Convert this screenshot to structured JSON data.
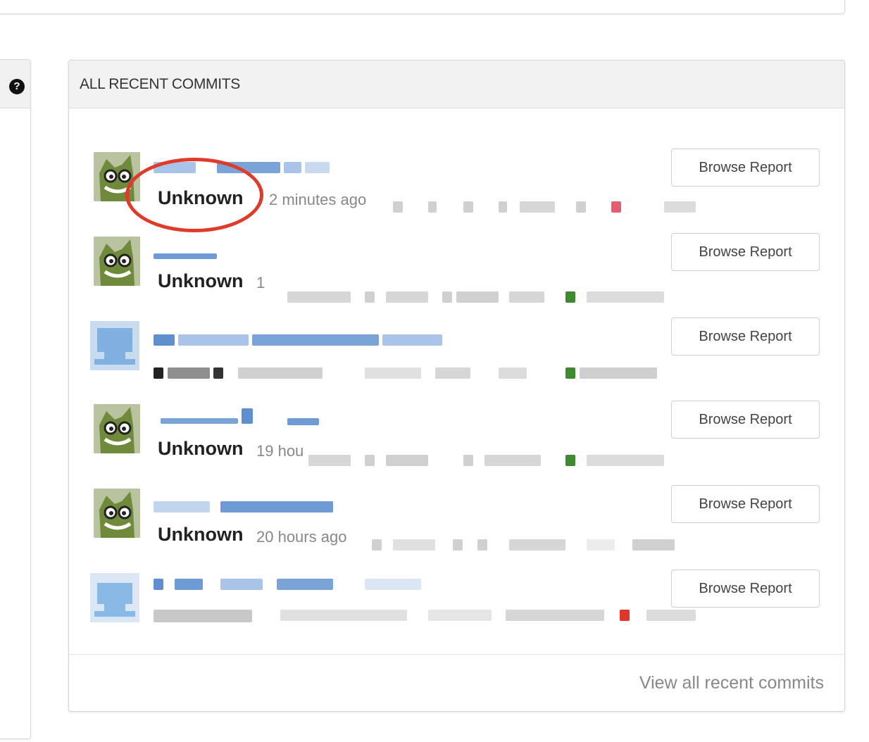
{
  "panel": {
    "title": "ALL RECENT COMMITS",
    "view_all_label": "View all recent commits"
  },
  "left_panel": {
    "help_icon": "question-circle-icon"
  },
  "commits": [
    {
      "author": "Unknown",
      "time": "2 minutes ago",
      "avatar": "monster-avatar-icon",
      "button_label": "Browse Report",
      "status_color": "#e06070"
    },
    {
      "author": "Unknown",
      "time": "1",
      "avatar": "monster-avatar-icon",
      "button_label": "Browse Report",
      "status_color": "#3f8a2e"
    },
    {
      "author": "",
      "time": "",
      "avatar": "generic-avatar-icon",
      "button_label": "Browse Report",
      "status_color": "#3f8a2e"
    },
    {
      "author": "Unknown",
      "time": "19 hou",
      "avatar": "monster-avatar-icon",
      "button_label": "Browse Report",
      "status_color": "#3f8a2e"
    },
    {
      "author": "Unknown",
      "time": "20 hours ago",
      "avatar": "monster-avatar-icon",
      "button_label": "Browse Report",
      "status_color": "#d0d0d0"
    },
    {
      "author": "",
      "time": "",
      "avatar": "generic-avatar-icon",
      "button_label": "Browse Report",
      "status_color": "#e0352a"
    }
  ],
  "annotation": {
    "color": "#e03a2a"
  }
}
